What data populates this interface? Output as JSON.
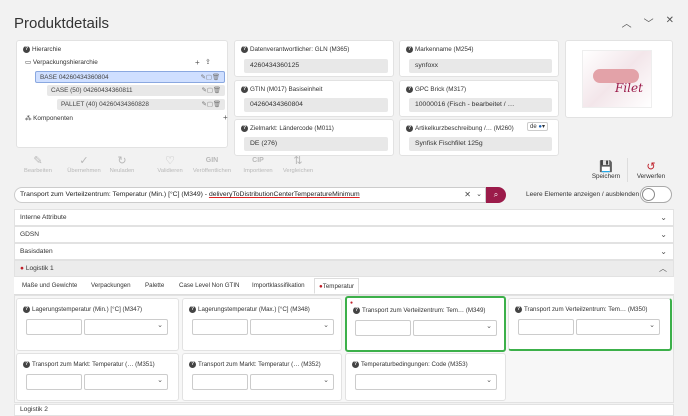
{
  "header": {
    "title": "Produktdetails"
  },
  "hierarchy": {
    "title": "Hierarchie",
    "packaging": "Verpackungshierarchie",
    "nodes": [
      "BASE 04260434360804",
      "CASE (50) 04260434360811",
      "PALLET (40) 04260434360828"
    ],
    "components": "Komponenten"
  },
  "fields": {
    "gln": {
      "label": "Datenverantwortlicher: GLN (M365)",
      "value": "4260434360125"
    },
    "brand": {
      "label": "Markenname (M254)",
      "value": "synfoxx"
    },
    "gtin": {
      "label": "GTIN (M017) Basiseinheit",
      "value": "04260434360804"
    },
    "gpc": {
      "label": "GPC Brick (M317)",
      "value": "10000016 (Fisch - bearbeitet / …"
    },
    "target": {
      "label": "Zielmarkt: Ländercode (M011)",
      "value": "DE (276)"
    },
    "shortdesc": {
      "label": "Artikelkurzbeschreibung /… (M260)",
      "value": "Synfisk Fischfilet 125g",
      "lang": "de"
    }
  },
  "product_image_text": "Filet",
  "toolbar": {
    "buttons": [
      "Bearbeiten",
      "Übernehmen",
      "Neuladen",
      "Validieren",
      "Veröffentlichen",
      "Importieren",
      "Vergleichen"
    ],
    "btn_short": [
      "GIN",
      "CIP"
    ],
    "save": "Speichern",
    "discard": "Verwerfen"
  },
  "search": {
    "value_prefix": "Transport zum Verteilzentrum: Temperatur (Min.) [°C] (M349) - ",
    "value_link": "deliveryToDistributionCenterTemperatureMinimum",
    "toggle_label": "Leere Elemente anzeigen / ausblenden"
  },
  "sections": [
    "Interne Attribute",
    "GDSN",
    "Basisdaten",
    "Logistik 1",
    "Logistik 2"
  ],
  "tabs": [
    "Maße und Gewichte",
    "Verpackungen",
    "Palette",
    "Case Level Non GTIN",
    "Importklassifikation",
    "Temperatur"
  ],
  "cards": [
    {
      "label": "Lagerungstemperatur (Min.) [°C] (M347)"
    },
    {
      "label": "Lagerungstemperatur (Max.) [°C] (M348)"
    },
    {
      "label": "Transport zum Verteilzentrum: Tem…  (M349)"
    },
    {
      "label": "Transport zum Verteilzentrum: Tem…  (M350)"
    },
    {
      "label": "Transport zum Markt: Temperatur (…  (M351)"
    },
    {
      "label": "Transport zum Markt: Temperatur (…  (M352)"
    },
    {
      "label": "Temperaturbedingungen: Code (M353)"
    }
  ],
  "colors": {
    "accent": "#9b1b4a",
    "highlight": "#3cb04a",
    "selected_node": "#cfdfff"
  }
}
